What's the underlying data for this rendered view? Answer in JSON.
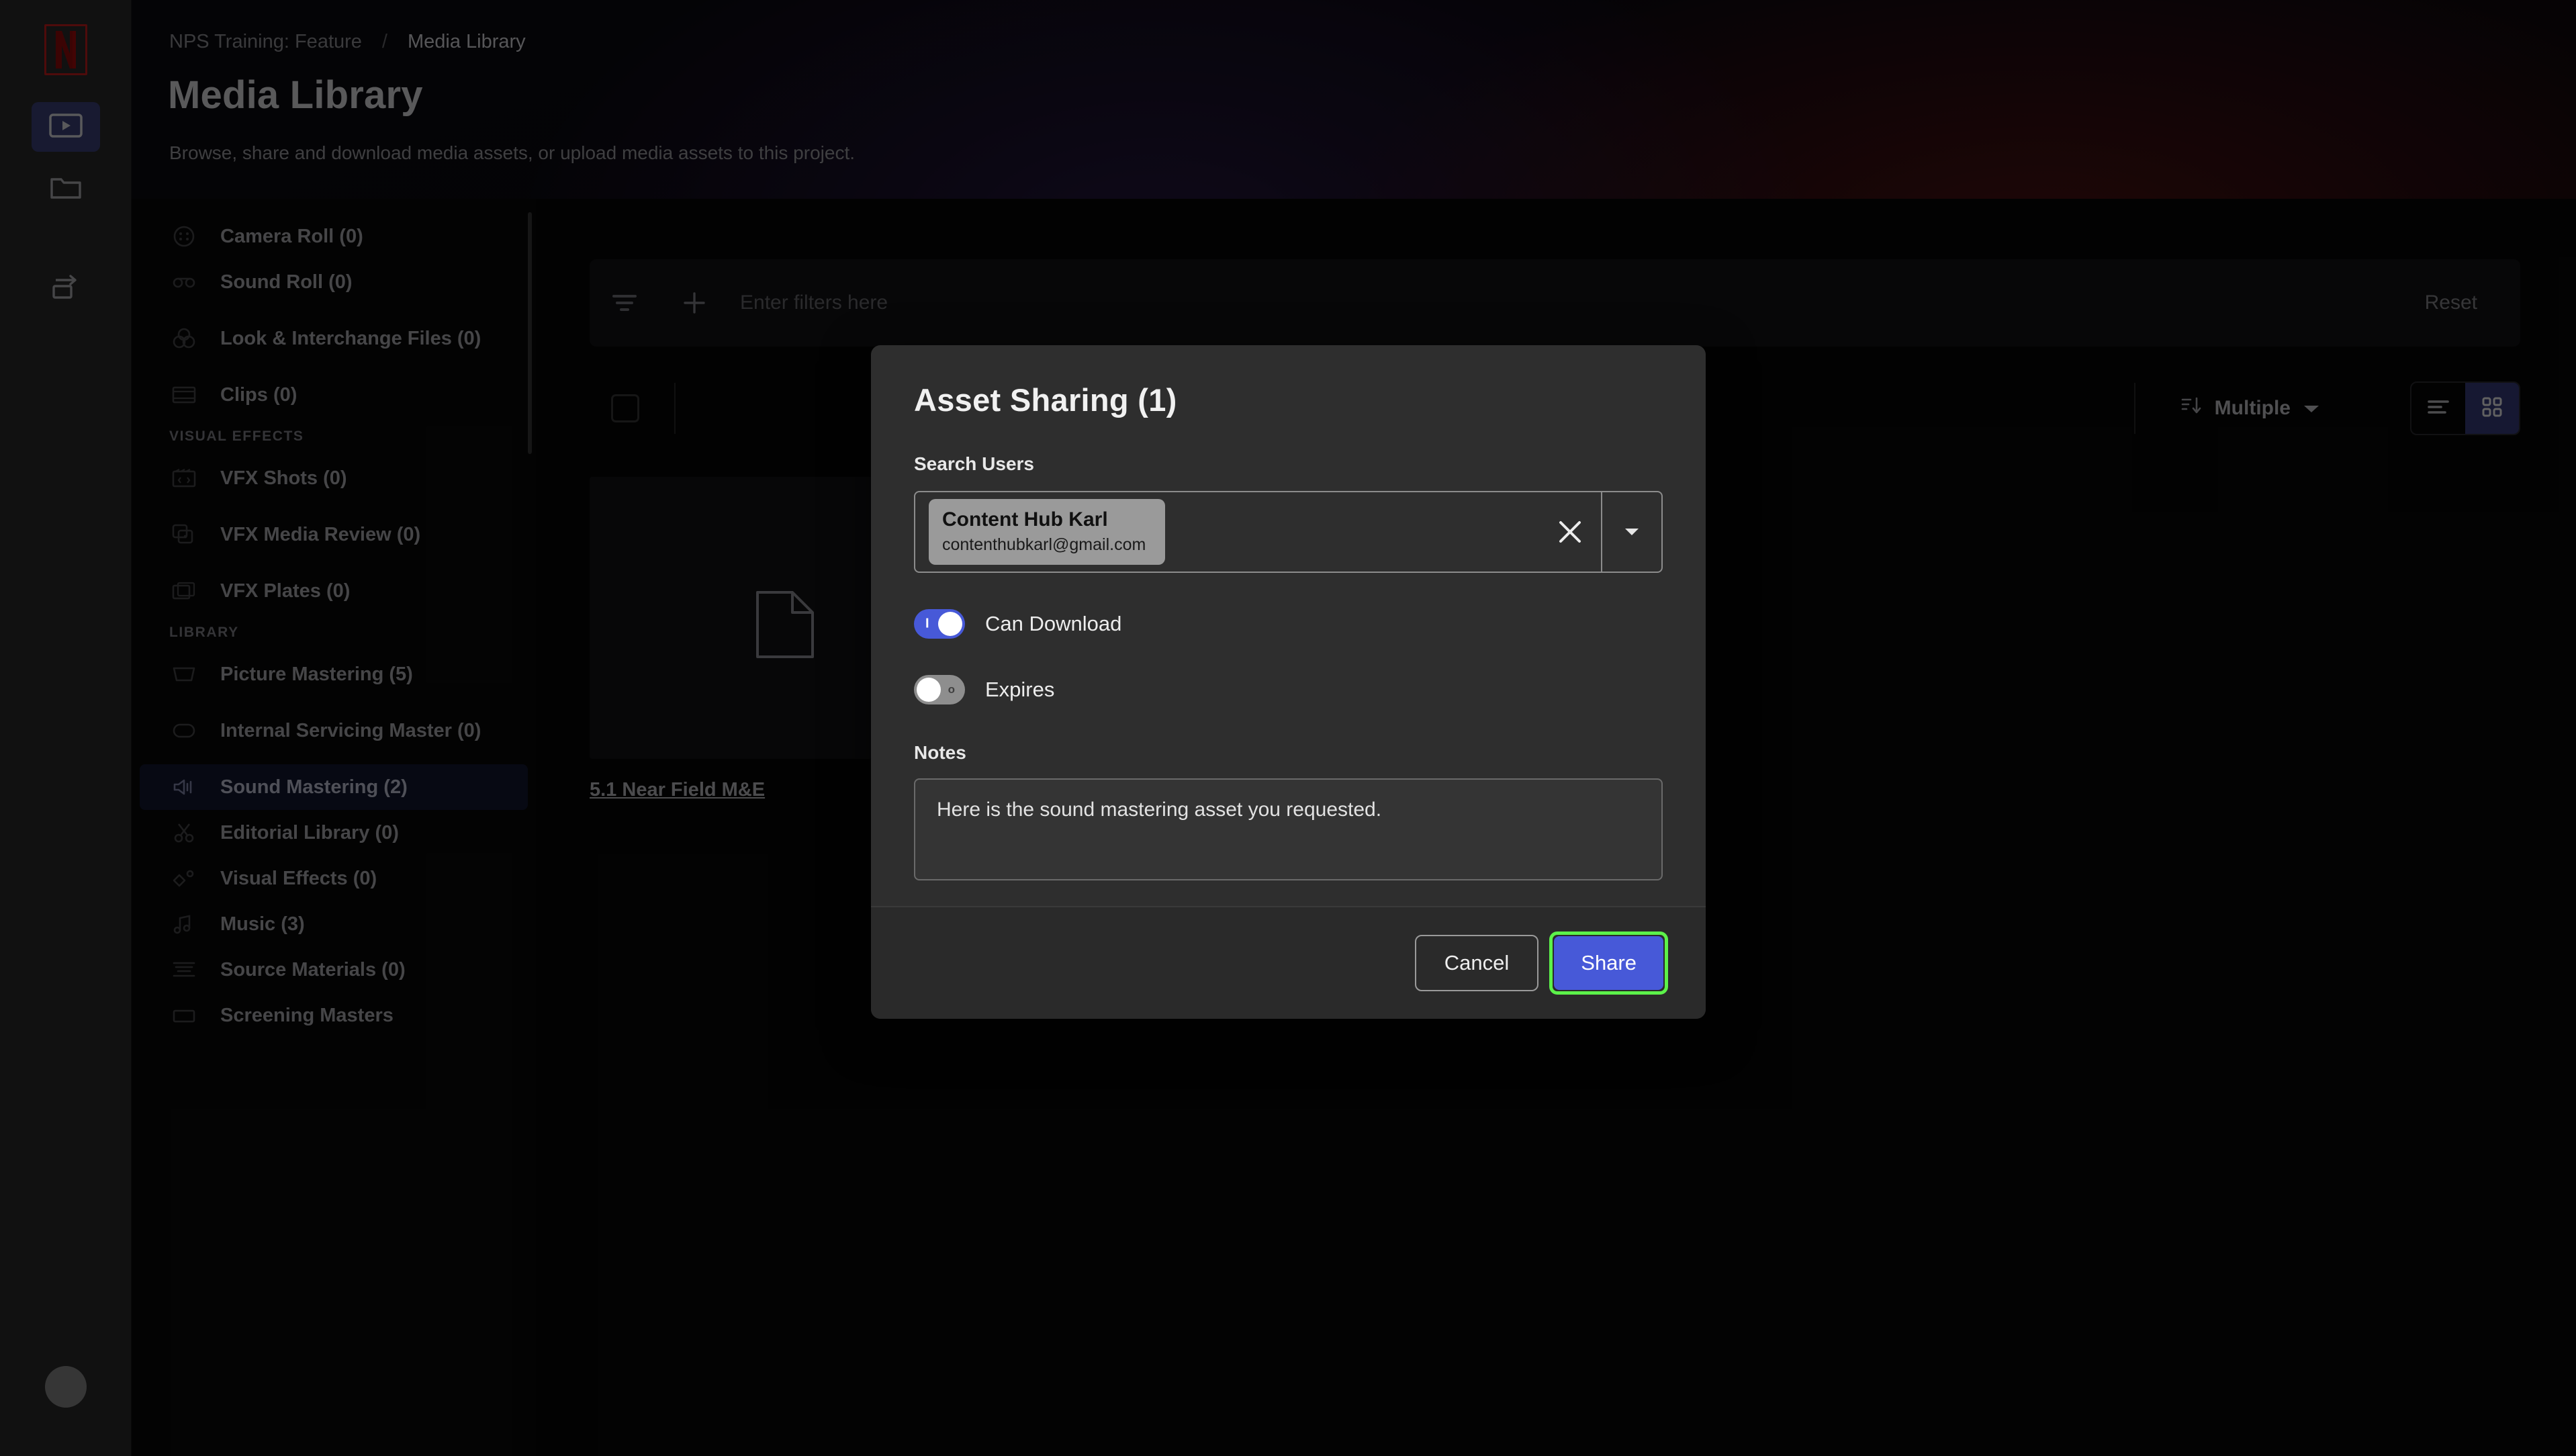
{
  "rail": {
    "logo": "netflix-logo",
    "items": [
      {
        "icon": "media-play-icon",
        "name": "media",
        "active": true
      },
      {
        "icon": "folder-icon",
        "name": "folders",
        "active": false
      },
      {
        "icon": "transfer-icon",
        "name": "transfers",
        "active": false
      }
    ],
    "avatar": "user-avatar"
  },
  "header": {
    "breadcrumb_project": "NPS Training: Feature",
    "breadcrumb_separator": "/",
    "breadcrumb_current": "Media Library",
    "title": "Media Library",
    "subtitle": "Browse, share and download media assets, or upload media assets to this project."
  },
  "sidebar": {
    "items": [
      {
        "label": "Camera Roll (0)",
        "icon": "camera-roll-icon",
        "selected": false,
        "tall": false
      },
      {
        "label": "Sound Roll (0)",
        "icon": "sound-roll-icon",
        "selected": false,
        "tall": false
      },
      {
        "label": "Look & Interchange Files (0)",
        "icon": "color-wheels-icon",
        "selected": false,
        "tall": true
      },
      {
        "label": "Clips (0)",
        "icon": "clips-icon",
        "selected": false,
        "tall": false
      }
    ],
    "group_vfx": "VISUAL EFFECTS",
    "vfx_items": [
      {
        "label": "VFX Shots (0)",
        "icon": "vfx-shots-icon",
        "selected": false,
        "tall": false
      },
      {
        "label": "VFX Media Review (0)",
        "icon": "vfx-media-review-icon",
        "selected": false,
        "tall": true
      },
      {
        "label": "VFX Plates (0)",
        "icon": "vfx-plates-icon",
        "selected": false,
        "tall": false
      }
    ],
    "group_library": "LIBRARY",
    "library_items": [
      {
        "label": "Picture Mastering (5)",
        "icon": "picture-mastering-icon",
        "selected": false,
        "tall": false
      },
      {
        "label": "Internal Servicing Master (0)",
        "icon": "internal-servicing-icon",
        "selected": false,
        "tall": true
      },
      {
        "label": "Sound Mastering (2)",
        "icon": "speaker-icon",
        "selected": true,
        "tall": false
      },
      {
        "label": "Editorial Library (0)",
        "icon": "scissors-icon",
        "selected": false,
        "tall": false
      },
      {
        "label": "Visual Effects (0)",
        "icon": "visual-effects-icon",
        "selected": false,
        "tall": false
      },
      {
        "label": "Music (3)",
        "icon": "music-note-icon",
        "selected": false,
        "tall": false
      },
      {
        "label": "Source Materials (0)",
        "icon": "source-materials-icon",
        "selected": false,
        "tall": false
      },
      {
        "label": "Screening Masters",
        "icon": "screening-masters-icon",
        "selected": false,
        "tall": false
      }
    ]
  },
  "toolbar": {
    "filter_placeholder": "Enter filters here",
    "reset_label": "Reset",
    "sort_label": "Multiple",
    "sort_icon": "sort-descending-icon",
    "select_all_checkbox": "select-all-checkbox",
    "list_view_icon": "list-view-icon",
    "grid_view_icon": "grid-view-icon",
    "active_view": "grid"
  },
  "assets": [
    {
      "name": "5.1 Near Field M&E",
      "thumb_icon": "document-icon"
    }
  ],
  "modal": {
    "title": "Asset Sharing (1)",
    "search_users_label": "Search Users",
    "token": {
      "name": "Content Hub Karl",
      "email": "contenthubkarl@gmail.com"
    },
    "clear_icon": "close-icon",
    "caret_icon": "chevron-down-icon",
    "toggles": [
      {
        "label": "Can Download",
        "state": "on",
        "mark": "I"
      },
      {
        "label": "Expires",
        "state": "off",
        "mark": "o"
      }
    ],
    "notes_label": "Notes",
    "notes_value": "Here is the sound mastering asset you requested.",
    "cancel_label": "Cancel",
    "share_label": "Share"
  },
  "colors": {
    "accent_blue": "#4759d8",
    "highlight_green": "#5cf24a",
    "brand_red": "#cc1f1f",
    "modal_bg": "#2e2e2e"
  }
}
